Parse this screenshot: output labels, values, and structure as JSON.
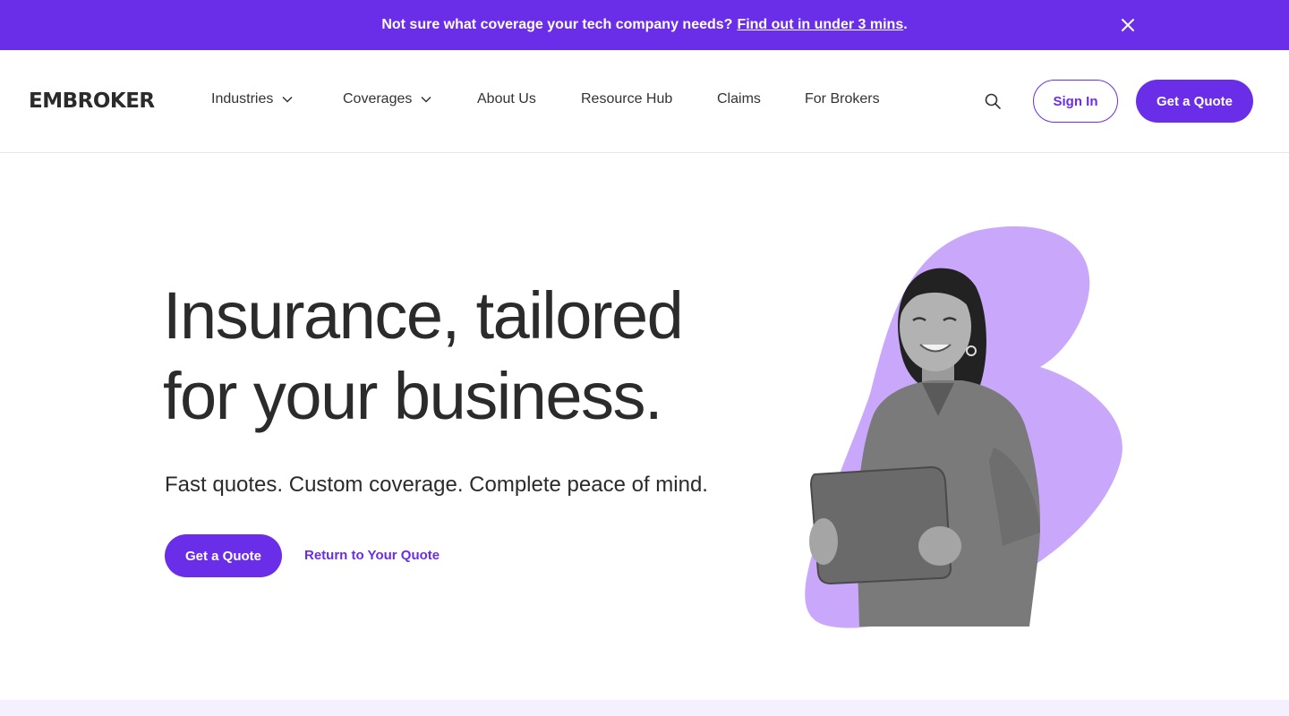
{
  "banner": {
    "text": "Not sure what coverage your tech company needs?",
    "link": "Find out in under 3 mins",
    "suffix": "."
  },
  "header": {
    "logo": "EMBROKER",
    "nav": [
      {
        "label": "Industries",
        "has_dropdown": true
      },
      {
        "label": "Coverages",
        "has_dropdown": true
      },
      {
        "label": "About Us",
        "has_dropdown": false
      },
      {
        "label": "Resource Hub",
        "has_dropdown": false
      },
      {
        "label": "Claims",
        "has_dropdown": false
      },
      {
        "label": "For Brokers",
        "has_dropdown": false
      }
    ],
    "sign_in": "Sign In",
    "get_quote": "Get a Quote"
  },
  "hero": {
    "title_line1": "Insurance, tailored",
    "title_line2": "for your business.",
    "subtitle": "Fast quotes. Custom coverage. Complete peace of mind.",
    "cta_primary": "Get a Quote",
    "cta_secondary": "Return to Your Quote"
  },
  "icons": {
    "close": "close-icon",
    "search": "search-icon",
    "chevron": "chevron-down-icon"
  },
  "colors": {
    "brand": "#6b2ee8",
    "accent_blob": "#c9a8fb",
    "text": "#2b2b2b",
    "band": "#f5f0fe"
  }
}
